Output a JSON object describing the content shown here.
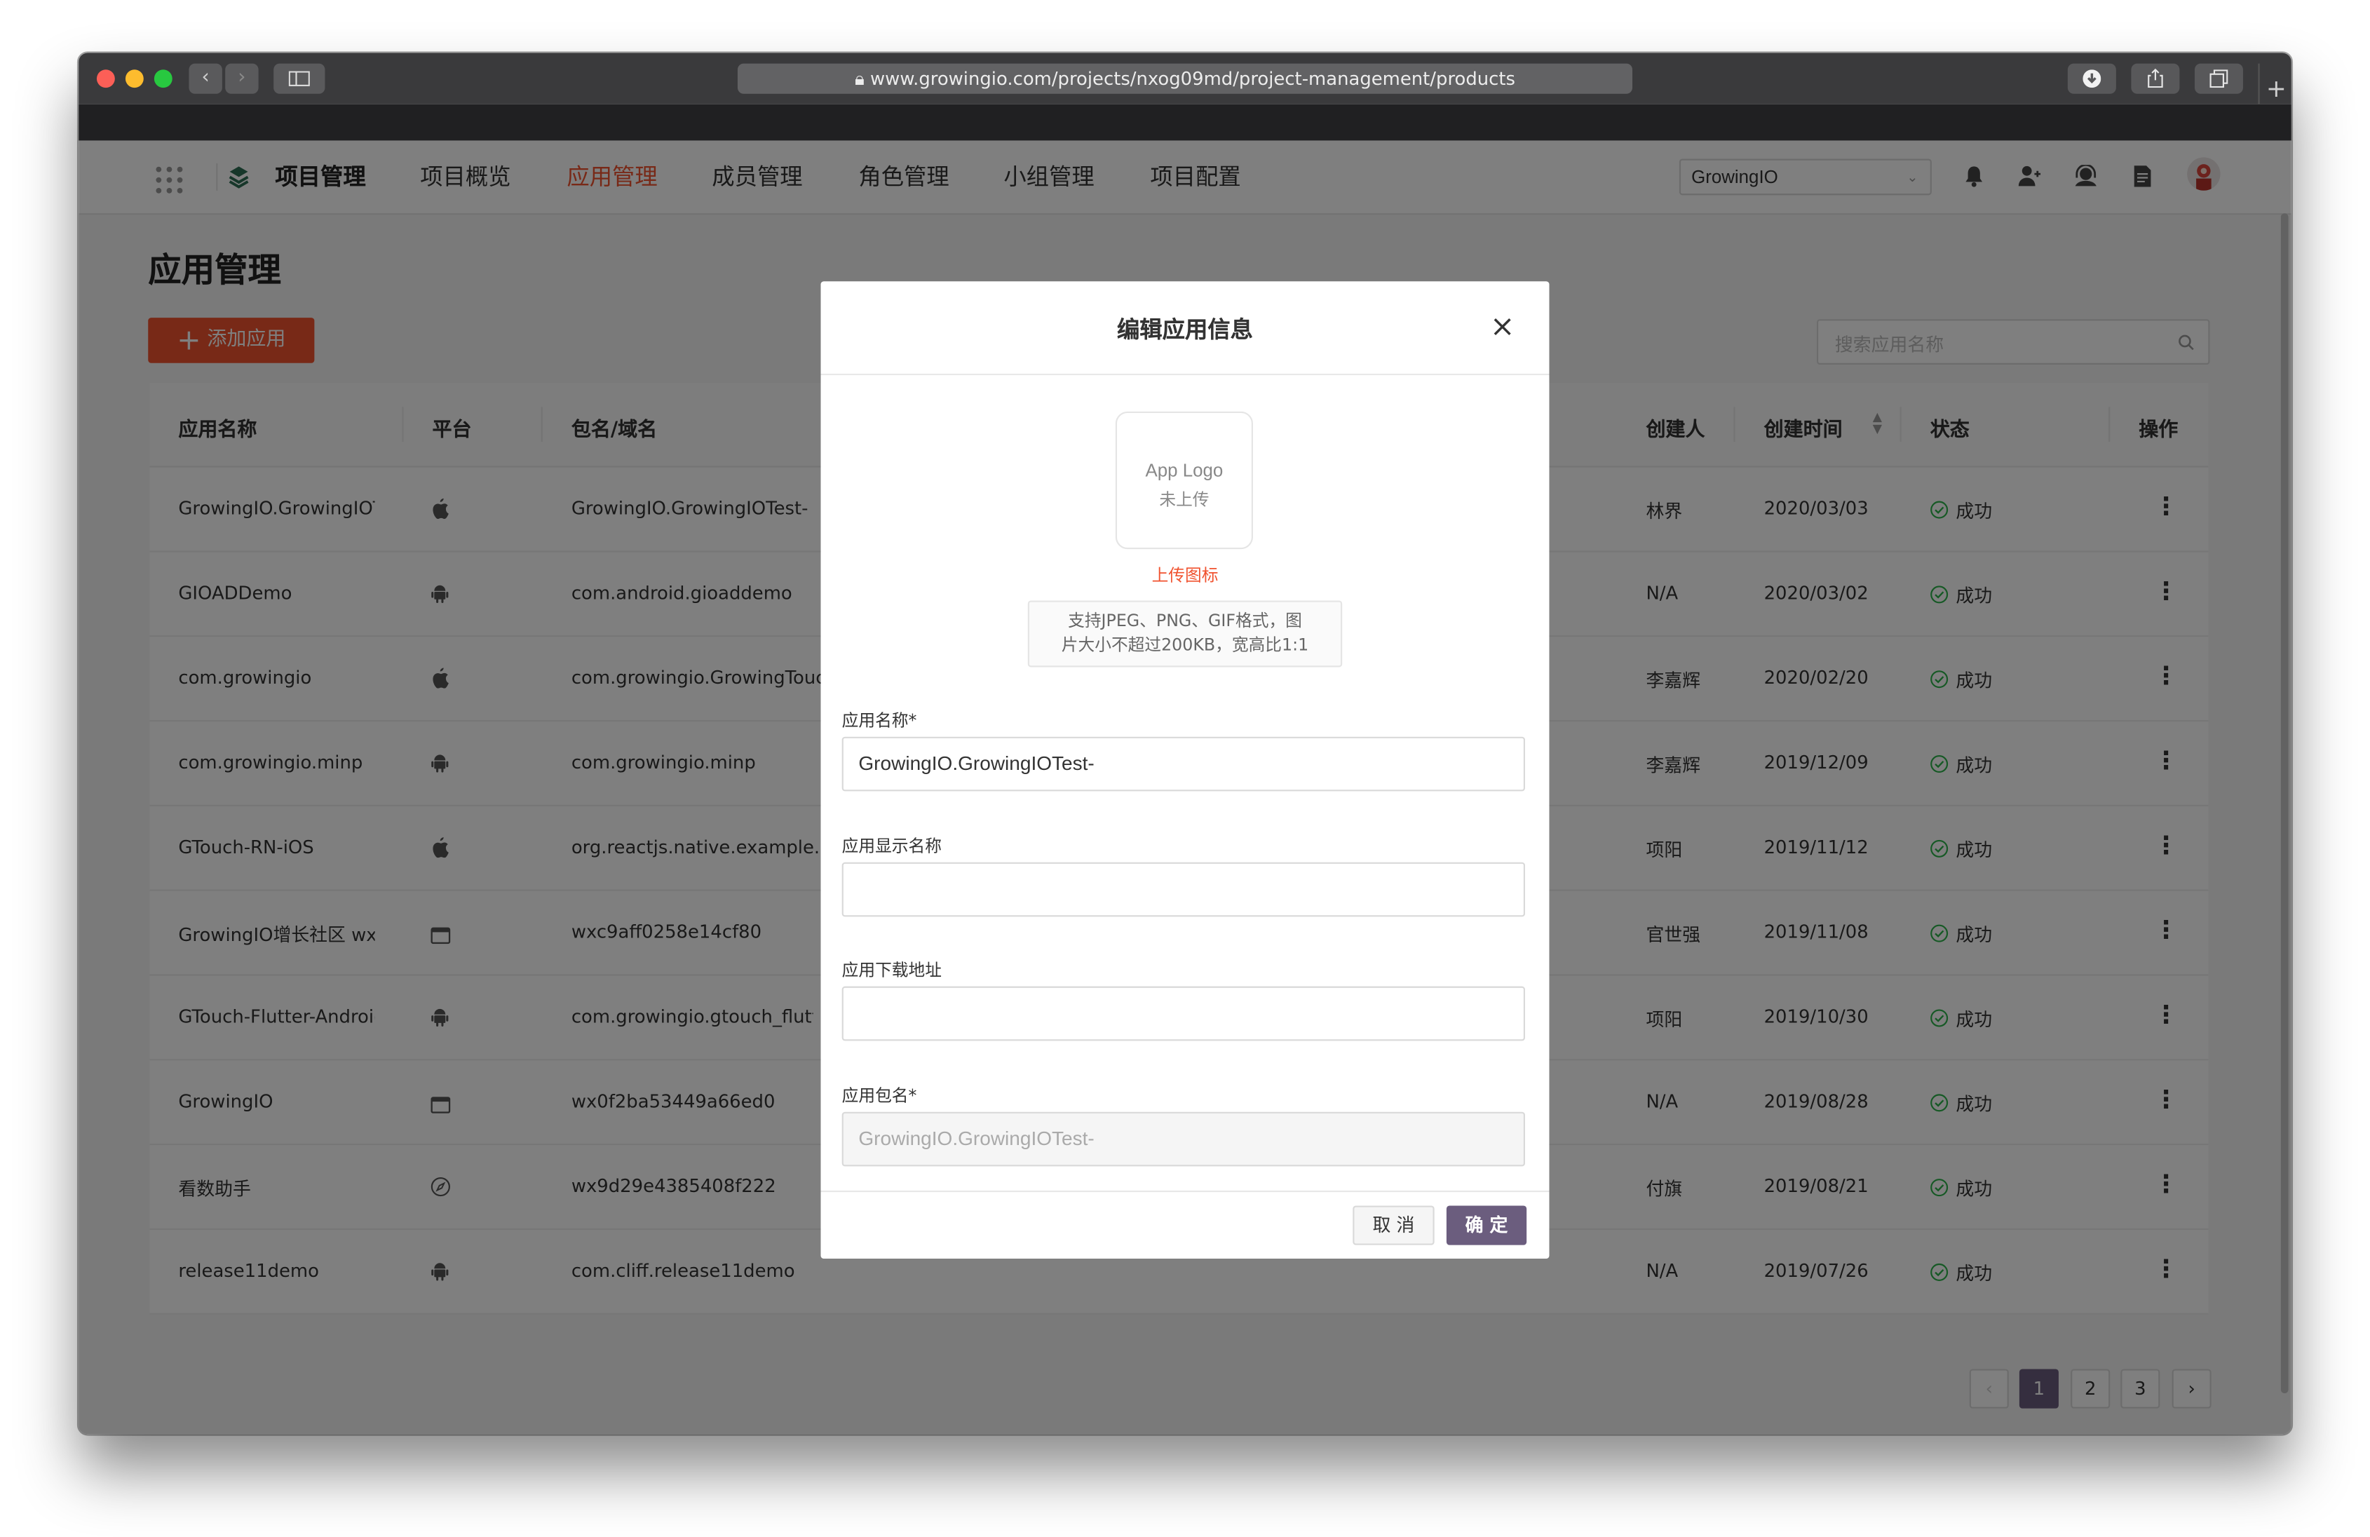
{
  "browser": {
    "url": "www.growingio.com/projects/nxog09md/project-management/products",
    "back": "‹",
    "forward": "›",
    "new_tab": "+"
  },
  "appbar": {
    "logo_title": "项目管理",
    "nav": [
      "项目概览",
      "应用管理",
      "成员管理",
      "角色管理",
      "小组管理",
      "项目配置"
    ],
    "active_nav": "应用管理",
    "project_select": "GrowingIO"
  },
  "page": {
    "title": "应用管理",
    "add_button": "添加应用",
    "search_placeholder": "搜索应用名称"
  },
  "table": {
    "headers": [
      "应用名称",
      "平台",
      "包名/域名",
      "创建人",
      "创建时间",
      "状态",
      "操作"
    ],
    "rows": [
      {
        "name": "GrowingIO.GrowingIOT...",
        "platform": "ios",
        "package": "GrowingIO.GrowingIOTest-",
        "creator": "林界",
        "created": "2020/03/03",
        "status": "成功"
      },
      {
        "name": "GIOADDemo",
        "platform": "android",
        "package": "com.android.gioaddemo",
        "creator": "N/A",
        "created": "2020/03/02",
        "status": "成功"
      },
      {
        "name": "com.growingio",
        "platform": "ios",
        "package": "com.growingio.GrowingTouchAut",
        "creator": "李嘉辉",
        "created": "2020/02/20",
        "status": "成功"
      },
      {
        "name": "com.growingio.minp",
        "platform": "android",
        "package": "com.growingio.minp",
        "creator": "李嘉辉",
        "created": "2019/12/09",
        "status": "成功"
      },
      {
        "name": "GTouch-RN-iOS",
        "platform": "ios",
        "package": "org.reactjs.native.example.examp",
        "creator": "项阳",
        "created": "2019/11/12",
        "status": "成功"
      },
      {
        "name": "GrowingIO增长社区 wx...",
        "platform": "miniprogram",
        "package": "wxc9aff0258e14cf80",
        "creator": "官世强",
        "created": "2019/11/08",
        "status": "成功"
      },
      {
        "name": "GTouch-Flutter-Android",
        "platform": "android",
        "package": "com.growingio.gtouch_flutter",
        "creator": "项阳",
        "created": "2019/10/30",
        "status": "成功"
      },
      {
        "name": "GrowingIO",
        "platform": "miniprogram",
        "package": "wx0f2ba53449a66ed0",
        "creator": "N/A",
        "created": "2019/08/28",
        "status": "成功"
      },
      {
        "name": "看数助手",
        "platform": "web",
        "package": "wx9d29e4385408f222",
        "creator": "付旗",
        "created": "2019/08/21",
        "status": "成功"
      },
      {
        "name": "release11demo",
        "platform": "android",
        "package": "com.cliff.release11demo",
        "creator": "N/A",
        "created": "2019/07/26",
        "status": "成功"
      }
    ]
  },
  "pagination": {
    "prev": "‹",
    "pages": [
      "1",
      "2",
      "3"
    ],
    "current": "1",
    "next": "›"
  },
  "modal": {
    "title": "编辑应用信息",
    "logo_line1": "App Logo",
    "logo_line2": "未上传",
    "upload_link": "上传图标",
    "hint_line1": "支持JPEG、PNG、GIF格式，图",
    "hint_line2": "片大小不超过200KB，宽高比1:1",
    "name_label": "应用名称*",
    "name_value": "GrowingIO.GrowingIOTest-",
    "display_label": "应用显示名称",
    "display_value": "",
    "download_label": "应用下载地址",
    "download_value": "",
    "package_label": "应用包名*",
    "package_value": "GrowingIO.GrowingIOTest-",
    "cancel": "取 消",
    "confirm": "确 定"
  },
  "colors": {
    "accent": "#f0522f",
    "primary": "#6b5d7e",
    "success": "#2cb34a"
  }
}
